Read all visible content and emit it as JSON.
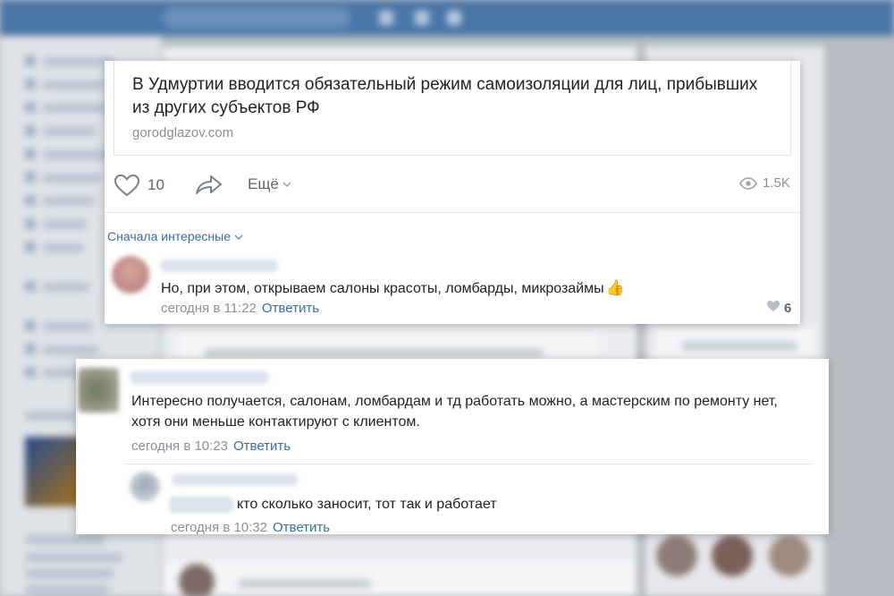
{
  "post": {
    "link_title": "В Удмуртии вводится обязательный режим самоизоляции для лиц, прибывших из других субъектов РФ",
    "link_domain": "gorodglazov.com",
    "like_count": "10",
    "more_label": "Ещё",
    "views": "1.5K",
    "sort_label": "Сначала интересные"
  },
  "comments": [
    {
      "text": "Но, при этом, открываем салоны красоты, ломбарды, микрозаймы",
      "emoji": "👍",
      "time": "сегодня в 11:22",
      "reply_label": "Ответить",
      "likes": "6"
    },
    {
      "text": "Интересно получается, салонам, ломбардам и тд работать можно, а мастерским по ремонту нет, хотя они меньше контактируют с клиентом.",
      "time": "сегодня в 10:23",
      "reply_label": "Ответить"
    },
    {
      "text": "кто сколько заносит, тот так и работает",
      "time": "сегодня в 10:32",
      "reply_label": "Ответить"
    }
  ],
  "colors": {
    "accent": "#3e6b9d",
    "topbar": "#4a76a8",
    "muted": "#8a8f96"
  },
  "icons": [
    "heart-icon",
    "share-icon",
    "chevron-down-icon",
    "eye-icon",
    "heart-small-icon",
    "thumbs-up-icon"
  ]
}
